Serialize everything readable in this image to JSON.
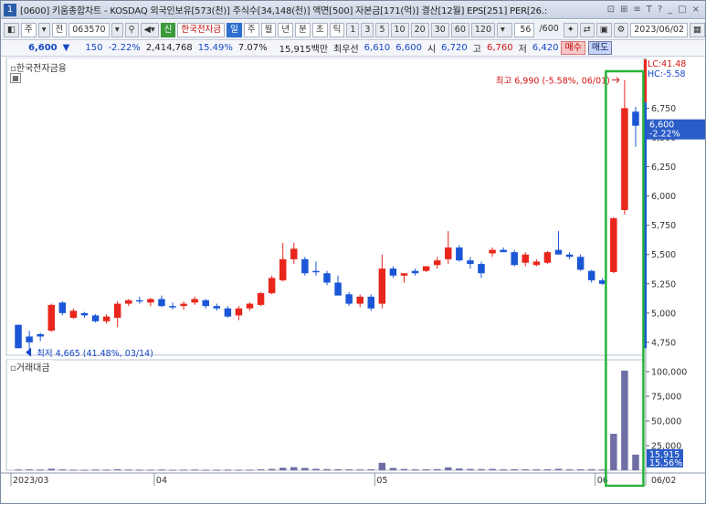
{
  "window": {
    "number": "1",
    "title": "[0600] 키움종합차트 - KOSDAQ 외국인보유[573(천)] 주식수[34,148(천)] 액면[500] 자본금[171(억)] 결산[12월] EPS[251] PER[26.:",
    "controls": [
      "⊡",
      "⊞",
      "≡",
      "T",
      "?",
      "_",
      "□",
      "×"
    ]
  },
  "toolbar": {
    "period_main": "주",
    "prev_label": "전",
    "code": "063570",
    "new_label": "신",
    "stock_name": "한국전자금",
    "periods": [
      "일",
      "주",
      "월",
      "년",
      "분",
      "초",
      "틱"
    ],
    "active_period": "일",
    "intervals": [
      "1",
      "3",
      "5",
      "10",
      "20",
      "30",
      "60",
      "120"
    ],
    "count": "56",
    "count_total": "/600",
    "date": "2023/06/02"
  },
  "quote": {
    "price": "6,600",
    "change_arrow": "▼",
    "change": "150",
    "change_pct": "-2.22%",
    "volume": "2,414,768",
    "turnover_pct": "15.49%",
    "ratio_pct": "7.07%",
    "amount": "15,915백만",
    "best_bid_label": "최우선",
    "best_ask": "6,610",
    "best_bid": "6,600",
    "open_label": "시",
    "open": "6,720",
    "high_label": "고",
    "high": "6,760",
    "low_label": "저",
    "low": "6,420",
    "buy_label": "매수",
    "sell_label": "매도"
  },
  "panels": {
    "price_title": "한국전자금융",
    "volume_title": "거래대금",
    "lc_label": "LC:41.48",
    "hc_label": "HC:-5.58",
    "current_price_tag": "6,600",
    "current_change_tag": "-2.22%",
    "high_annotation": "최고 6,990 (-5.58%, 06/01)",
    "low_annotation": "최저 4,665 (41.48%, 03/14)",
    "vol_tag_1": "15,915",
    "vol_tag_2": "15.56%"
  },
  "chart_data": {
    "type": "candlestick",
    "price_ticks": [
      4750,
      5000,
      5250,
      5500,
      5750,
      6000,
      6250,
      6500,
      6750
    ],
    "price_tick_labels": [
      "4,750",
      "5,000",
      "5,250",
      "5,500",
      "5,750",
      "6,000",
      "6,250",
      "6,500",
      "6,750"
    ],
    "price_range": [
      4640,
      7120
    ],
    "volume_ticks": [
      25000,
      50000,
      75000,
      100000
    ],
    "volume_tick_labels": [
      "25,000",
      "50,000",
      "75,000",
      "100,000"
    ],
    "volume_range": [
      0,
      112000
    ],
    "x_labels": [
      {
        "index": 0,
        "label": "2023/03"
      },
      {
        "index": 13,
        "label": "04"
      },
      {
        "index": 33,
        "label": "05"
      },
      {
        "index": 53,
        "label": "06"
      }
    ],
    "last_date_label": "06/02",
    "candles": [
      {
        "o": 4900,
        "h": 4900,
        "l": 4700,
        "c": 4700,
        "v": 800
      },
      {
        "o": 4800,
        "h": 4850,
        "l": 4665,
        "c": 4750,
        "v": 900
      },
      {
        "o": 4820,
        "h": 4830,
        "l": 4760,
        "c": 4800,
        "v": 700
      },
      {
        "o": 4850,
        "h": 5080,
        "l": 4840,
        "c": 5070,
        "v": 1600
      },
      {
        "o": 5090,
        "h": 5100,
        "l": 4980,
        "c": 5000,
        "v": 900
      },
      {
        "o": 4960,
        "h": 5040,
        "l": 4950,
        "c": 5020,
        "v": 600
      },
      {
        "o": 5000,
        "h": 5010,
        "l": 4960,
        "c": 4980,
        "v": 500
      },
      {
        "o": 4980,
        "h": 4990,
        "l": 4920,
        "c": 4930,
        "v": 700
      },
      {
        "o": 4930,
        "h": 4990,
        "l": 4910,
        "c": 4970,
        "v": 600
      },
      {
        "o": 4960,
        "h": 5100,
        "l": 4880,
        "c": 5080,
        "v": 1100
      },
      {
        "o": 5080,
        "h": 5120,
        "l": 5060,
        "c": 5110,
        "v": 700
      },
      {
        "o": 5110,
        "h": 5140,
        "l": 5080,
        "c": 5100,
        "v": 600
      },
      {
        "o": 5090,
        "h": 5130,
        "l": 5060,
        "c": 5120,
        "v": 600
      },
      {
        "o": 5120,
        "h": 5150,
        "l": 5050,
        "c": 5060,
        "v": 700
      },
      {
        "o": 5060,
        "h": 5090,
        "l": 5030,
        "c": 5050,
        "v": 500
      },
      {
        "o": 5060,
        "h": 5100,
        "l": 5030,
        "c": 5080,
        "v": 600
      },
      {
        "o": 5090,
        "h": 5140,
        "l": 5070,
        "c": 5120,
        "v": 700
      },
      {
        "o": 5110,
        "h": 5120,
        "l": 5040,
        "c": 5060,
        "v": 500
      },
      {
        "o": 5060,
        "h": 5080,
        "l": 5020,
        "c": 5040,
        "v": 500
      },
      {
        "o": 5040,
        "h": 5060,
        "l": 4960,
        "c": 4970,
        "v": 600
      },
      {
        "o": 4980,
        "h": 5060,
        "l": 4940,
        "c": 5040,
        "v": 500
      },
      {
        "o": 5040,
        "h": 5090,
        "l": 5020,
        "c": 5080,
        "v": 600
      },
      {
        "o": 5070,
        "h": 5180,
        "l": 5060,
        "c": 5170,
        "v": 900
      },
      {
        "o": 5170,
        "h": 5320,
        "l": 5160,
        "c": 5300,
        "v": 1400
      },
      {
        "o": 5280,
        "h": 5600,
        "l": 5270,
        "c": 5460,
        "v": 2600
      },
      {
        "o": 5460,
        "h": 5600,
        "l": 5420,
        "c": 5550,
        "v": 3200
      },
      {
        "o": 5460,
        "h": 5480,
        "l": 5320,
        "c": 5340,
        "v": 2400
      },
      {
        "o": 5360,
        "h": 5440,
        "l": 5320,
        "c": 5350,
        "v": 1500
      },
      {
        "o": 5340,
        "h": 5360,
        "l": 5240,
        "c": 5260,
        "v": 1200
      },
      {
        "o": 5260,
        "h": 5320,
        "l": 5150,
        "c": 5150,
        "v": 1100
      },
      {
        "o": 5160,
        "h": 5180,
        "l": 5060,
        "c": 5080,
        "v": 900
      },
      {
        "o": 5080,
        "h": 5160,
        "l": 5050,
        "c": 5140,
        "v": 800
      },
      {
        "o": 5140,
        "h": 5160,
        "l": 5020,
        "c": 5040,
        "v": 1000
      },
      {
        "o": 5080,
        "h": 5500,
        "l": 5040,
        "c": 5380,
        "v": 7600
      },
      {
        "o": 5380,
        "h": 5400,
        "l": 5300,
        "c": 5320,
        "v": 2400
      },
      {
        "o": 5320,
        "h": 5340,
        "l": 5260,
        "c": 5340,
        "v": 1300
      },
      {
        "o": 5360,
        "h": 5380,
        "l": 5320,
        "c": 5340,
        "v": 900
      },
      {
        "o": 5360,
        "h": 5400,
        "l": 5350,
        "c": 5400,
        "v": 1000
      },
      {
        "o": 5410,
        "h": 5480,
        "l": 5380,
        "c": 5450,
        "v": 1200
      },
      {
        "o": 5460,
        "h": 5700,
        "l": 5420,
        "c": 5560,
        "v": 3000
      },
      {
        "o": 5560,
        "h": 5580,
        "l": 5440,
        "c": 5450,
        "v": 1800
      },
      {
        "o": 5450,
        "h": 5480,
        "l": 5380,
        "c": 5420,
        "v": 1300
      },
      {
        "o": 5420,
        "h": 5440,
        "l": 5300,
        "c": 5340,
        "v": 1200
      },
      {
        "o": 5510,
        "h": 5560,
        "l": 5480,
        "c": 5540,
        "v": 1400
      },
      {
        "o": 5540,
        "h": 5560,
        "l": 5520,
        "c": 5520,
        "v": 900
      },
      {
        "o": 5520,
        "h": 5540,
        "l": 5400,
        "c": 5410,
        "v": 1100
      },
      {
        "o": 5430,
        "h": 5520,
        "l": 5400,
        "c": 5500,
        "v": 1000
      },
      {
        "o": 5410,
        "h": 5460,
        "l": 5400,
        "c": 5440,
        "v": 900
      },
      {
        "o": 5430,
        "h": 5530,
        "l": 5420,
        "c": 5520,
        "v": 1000
      },
      {
        "o": 5540,
        "h": 5700,
        "l": 5510,
        "c": 5500,
        "v": 1500
      },
      {
        "o": 5500,
        "h": 5520,
        "l": 5460,
        "c": 5480,
        "v": 900
      },
      {
        "o": 5480,
        "h": 5500,
        "l": 5360,
        "c": 5370,
        "v": 1000
      },
      {
        "o": 5360,
        "h": 5370,
        "l": 5260,
        "c": 5280,
        "v": 1100
      },
      {
        "o": 5280,
        "h": 5300,
        "l": 5240,
        "c": 5250,
        "v": 900
      },
      {
        "o": 5350,
        "h": 5820,
        "l": 5340,
        "c": 5810,
        "v": 37000
      },
      {
        "o": 5880,
        "h": 6990,
        "l": 5840,
        "c": 6750,
        "v": 101000
      },
      {
        "o": 6720,
        "h": 6760,
        "l": 6420,
        "c": 6600,
        "v": 15915
      }
    ]
  },
  "colors": {
    "up": "#e8261c",
    "down": "#1a56d6",
    "volume": "#6f6fa6",
    "highlight_box": "#25b53a"
  }
}
